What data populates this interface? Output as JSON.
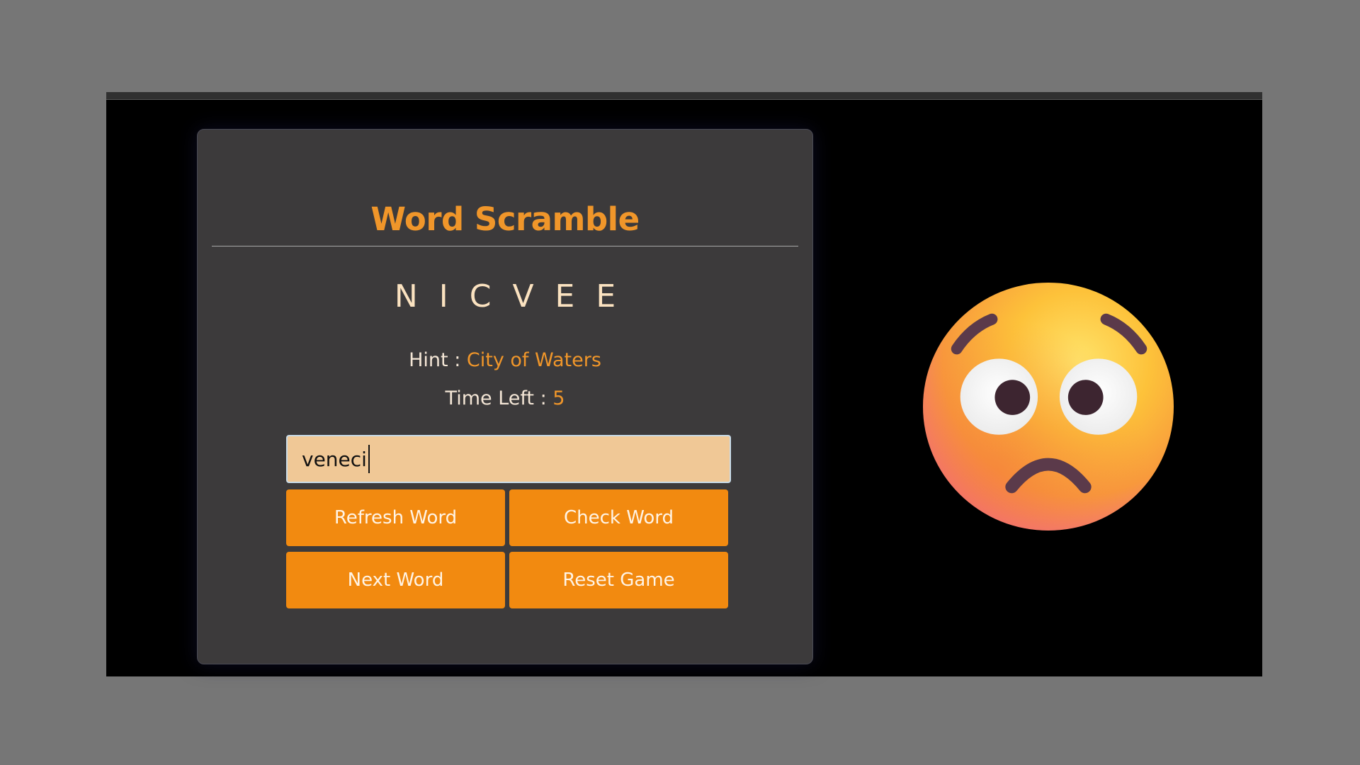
{
  "game": {
    "title": "Word Scramble",
    "scrambled_word": "NICVEE",
    "hint_label": "Hint :",
    "hint_value": "City of Waters",
    "time_label": "Time Left :",
    "time_value": "5",
    "input": {
      "value": "veneci",
      "placeholder": ""
    },
    "buttons": {
      "refresh": "Refresh Word",
      "check": "Check Word",
      "next": "Next Word",
      "reset": "Reset Game"
    }
  },
  "side_image": {
    "icon": "worried-face-emoji"
  },
  "colors": {
    "accent": "#f0962a",
    "button": "#f28a10",
    "card": "#3c3a3b",
    "input_bg": "#f0c896",
    "page_bg": "#767676"
  }
}
